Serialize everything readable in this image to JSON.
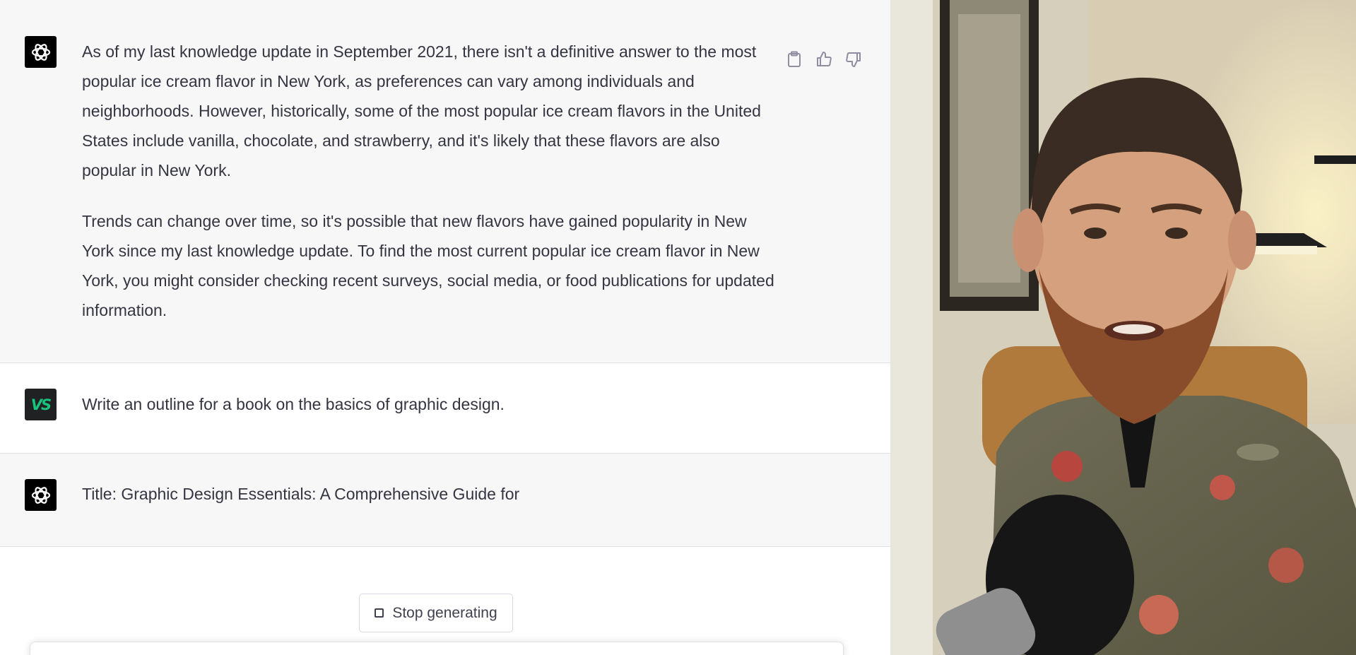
{
  "conversation": {
    "messages": [
      {
        "role": "assistant",
        "avatar_icon": "openai-logo-icon",
        "paragraphs": [
          "As of my last knowledge update in September 2021, there isn't a definitive answer to the most popular ice cream flavor in New York, as preferences can vary among individuals and neighborhoods. However, historically, some of the most popular ice cream flavors in the United States include vanilla, chocolate, and strawberry, and it's likely that these flavors are also popular in New York.",
          "Trends can change over time, so it's possible that new flavors have gained popularity in New York since my last knowledge update. To find the most current popular ice cream flavor in New York, you might consider checking recent surveys, social media, or food publications for updated information."
        ],
        "actions": [
          "clipboard-icon",
          "thumbs-up-icon",
          "thumbs-down-icon"
        ]
      },
      {
        "role": "user",
        "avatar_initials": "VS",
        "text": "Write an outline for a book on the basics of graphic design."
      },
      {
        "role": "assistant",
        "avatar_icon": "openai-logo-icon",
        "text": "Title: Graphic Design Essentials: A Comprehensive Guide for"
      }
    ],
    "stop_button_label": "Stop generating"
  },
  "colors": {
    "assistant_bg": "#f7f7f8",
    "user_avatar_bg": "#202123",
    "user_avatar_text": "#19c37d",
    "text": "#343541"
  }
}
